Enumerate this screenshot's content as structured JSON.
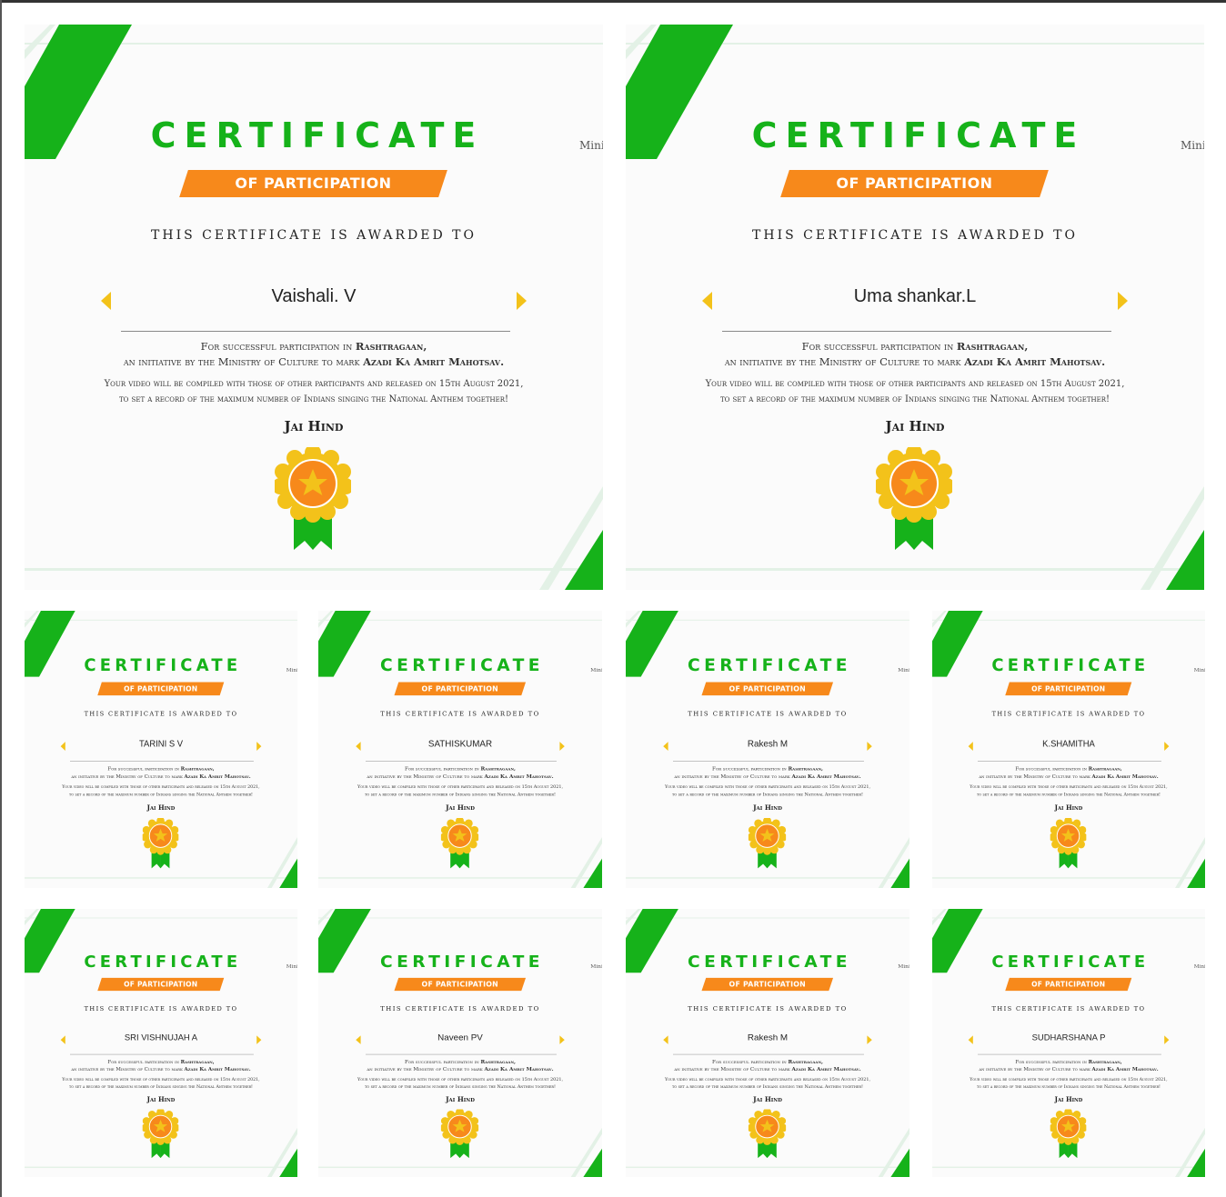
{
  "certificate": {
    "title": "CERTIFICATE",
    "subtitle": "OF PARTICIPATION",
    "awarded_to": "THIS CERTIFICATE IS AWARDED TO",
    "line1_a": "For successful participation in ",
    "line1_b": "Rashtragaan,",
    "line2_a": "an initiative by the Ministry of Culture to mark ",
    "line2_b": "Azadi Ka Amrit Mahotsav.",
    "line3": "Your video will be compiled with those of other participants and released on 15th August 2021,",
    "line4": "to set a record of the maximum number of Indians singing the National Anthem together!",
    "sign_off": "Jai Hind",
    "side_text": "Mini"
  },
  "colors": {
    "green": "#16b21a",
    "orange": "#f7891b",
    "gold": "#f3c21a",
    "pale_green": "#e3f1e6"
  },
  "certificates": [
    {
      "name": "Vaishali. V"
    },
    {
      "name": "Uma shankar.L"
    },
    {
      "name": "TARINI S V"
    },
    {
      "name": "SATHISKUMAR"
    },
    {
      "name": "Rakesh M"
    },
    {
      "name": "K.SHAMITHA"
    },
    {
      "name": "SRI VISHNUJAH A"
    },
    {
      "name": "Naveen PV"
    },
    {
      "name": "Rakesh M"
    },
    {
      "name": "SUDHARSHANA P"
    }
  ]
}
